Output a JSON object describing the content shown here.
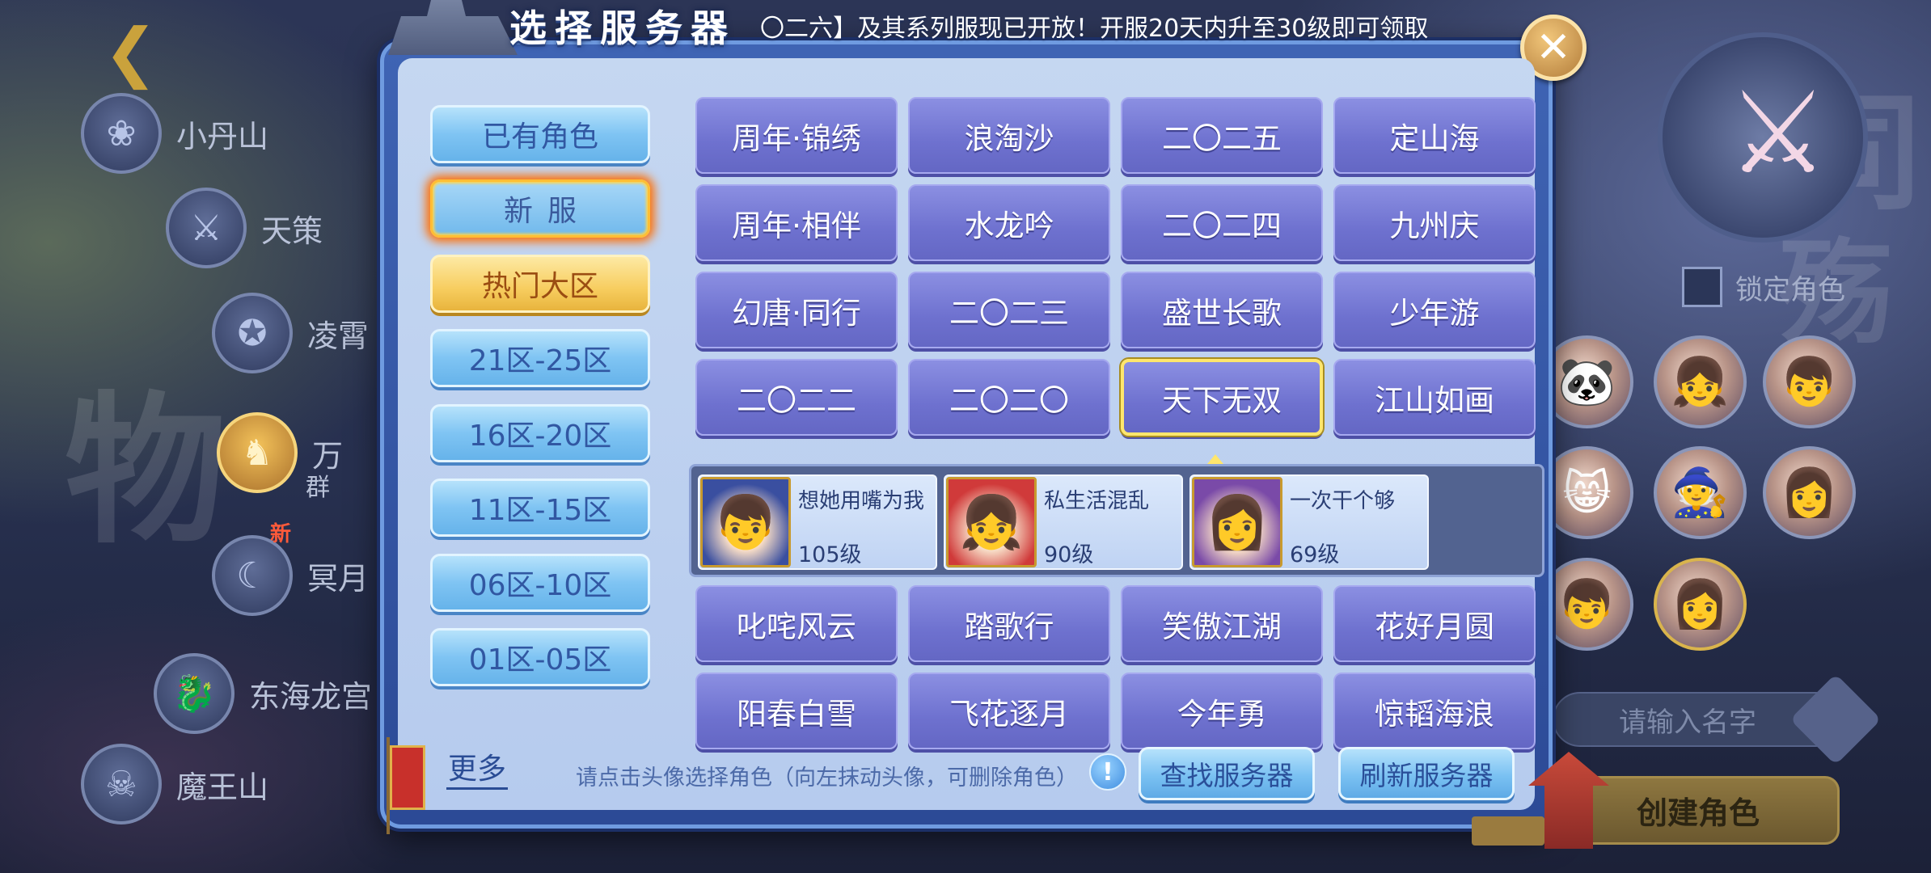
{
  "dialog": {
    "title": "选择服务器",
    "marquee": "〇二六】及其系列服现已开放！开服20天内升至30级即可领取",
    "close_icon": "close-icon"
  },
  "tabs": [
    {
      "label": "已有角色",
      "state": "normal"
    },
    {
      "label": "新服",
      "state": "fire"
    },
    {
      "label": "热门大区",
      "state": "hot"
    },
    {
      "label": "21区-25区",
      "state": "normal"
    },
    {
      "label": "16区-20区",
      "state": "normal"
    },
    {
      "label": "11区-15区",
      "state": "normal"
    },
    {
      "label": "06区-10区",
      "state": "normal"
    },
    {
      "label": "01区-05区",
      "state": "normal"
    }
  ],
  "servers_top": [
    [
      "周年·锦绣",
      "浪淘沙",
      "二〇二五",
      "定山海"
    ],
    [
      "周年·相伴",
      "水龙吟",
      "二〇二四",
      "九州庆"
    ],
    [
      "幻唐·同行",
      "二〇二三",
      "盛世长歌",
      "少年游"
    ],
    [
      "二〇二二",
      "二〇二〇",
      "天下无双",
      "江山如画"
    ]
  ],
  "selected_server": "天下无双",
  "roles": [
    {
      "name": "想她用嘴为我",
      "level": "105级",
      "avatar_icon": "blue-hair-hero-icon",
      "color": "#3a4fa0"
    },
    {
      "name": "私生活混乱",
      "level": "90级",
      "avatar_icon": "red-hair-hero-icon",
      "color": "#d03a3a"
    },
    {
      "name": "一次干个够",
      "level": "69级",
      "avatar_icon": "purple-hair-hero-icon",
      "color": "#7a4aa8"
    }
  ],
  "servers_bottom": [
    [
      "叱咤风云",
      "踏歌行",
      "笑傲江湖",
      "花好月圆"
    ],
    [
      "阳春白雪",
      "飞花逐月",
      "今年勇",
      "惊韬海浪"
    ]
  ],
  "footer": {
    "more_label": "更多",
    "hint": "请点击头像选择角色（向左抹动头像，可删除角色）",
    "find_button": "查找服务器",
    "refresh_button": "刷新服务器"
  },
  "background": {
    "factions": [
      {
        "name": "小丹山"
      },
      {
        "name": "天策"
      },
      {
        "name": "凌霄"
      },
      {
        "name": "万",
        "sub": "群"
      },
      {
        "name": "冥月",
        "tag": "新"
      },
      {
        "name": "东海龙宫"
      },
      {
        "name": "魔王山"
      }
    ],
    "lock_label": "锁定角色",
    "name_placeholder": "请输入名字",
    "create_label": "创建角色"
  },
  "colors": {
    "server_button": "#7275d3",
    "tab_blue": "#7fc4f3",
    "tab_hot": "#f7cd5f",
    "selected_border": "#ffe66d"
  }
}
